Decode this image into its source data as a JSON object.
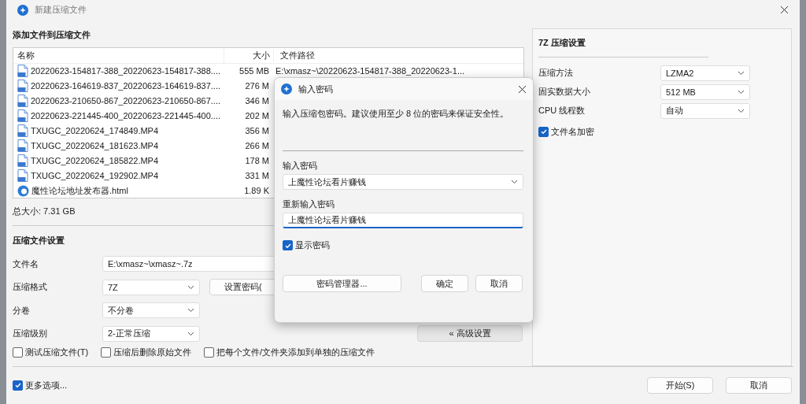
{
  "window": {
    "title": "新建压缩文件"
  },
  "files_section": {
    "title": "添加文件到压缩文件",
    "columns": [
      "名称",
      "大小",
      "文件路径"
    ],
    "rows": [
      {
        "kind": "video",
        "name": "20220623-154817-388_20220623-154817-388....",
        "size": "555 MB",
        "path": "E:\\xmasz~\\20220623-154817-388_20220623-1..."
      },
      {
        "kind": "video",
        "name": "20220623-164619-837_20220623-164619-837....",
        "size": "276 M"
      },
      {
        "kind": "video",
        "name": "20220623-210650-867_20220623-210650-867....",
        "size": "346 M"
      },
      {
        "kind": "video",
        "name": "20220623-221445-400_20220623-221445-400....",
        "size": "202 M"
      },
      {
        "kind": "video",
        "name": "TXUGC_20220624_174849.MP4",
        "size": "356 M"
      },
      {
        "kind": "video",
        "name": "TXUGC_20220624_181623.MP4",
        "size": "266 M"
      },
      {
        "kind": "video",
        "name": "TXUGC_20220624_185822.MP4",
        "size": "178 M"
      },
      {
        "kind": "video",
        "name": "TXUGC_20220624_192902.MP4",
        "size": "331 M"
      },
      {
        "kind": "web",
        "name": "魔性论坛地址发布器.html",
        "size": "1.89 K"
      }
    ],
    "total": "总大小: 7.31 GB"
  },
  "settings": {
    "title": "压缩文件设置",
    "fields": [
      {
        "kind": "text",
        "label": "文件名",
        "value": "E:\\xmasz~\\xmasz~.7z"
      },
      {
        "kind": "select",
        "label": "压缩格式",
        "value": "7Z"
      },
      {
        "kind": "select",
        "label": "分卷",
        "value": "不分卷"
      },
      {
        "kind": "select",
        "label": "压缩级别",
        "value": "2-正常压缩"
      }
    ],
    "password_button": "设置密码(",
    "advanced_button": "« 高级设置",
    "options": [
      {
        "label": "测试压缩文件(T)",
        "checked": false
      },
      {
        "label": "压缩后删除原始文件",
        "checked": false
      },
      {
        "label": "把每个文件/文件夹添加到单独的压缩文件",
        "checked": false
      }
    ]
  },
  "right_panel": {
    "title": "7Z 压缩设置",
    "fields": [
      {
        "label": "压缩方法",
        "value": "LZMA2"
      },
      {
        "label": "固实数据大小",
        "value": "512 MB"
      },
      {
        "label": "CPU 线程数",
        "value": "自动"
      }
    ],
    "checkbox": {
      "label": "文件名加密",
      "checked": true
    }
  },
  "bottom": {
    "more_options": {
      "label": "更多选项...",
      "checked": true
    },
    "buttons": [
      "开始(S)",
      "取消"
    ]
  },
  "dialog": {
    "title": "输入密码",
    "message": "输入压缩包密码。建议使用至少 8 位的密码来保证安全性。",
    "password_label": "输入密码",
    "password_value": "上魔性论坛看片赚钱",
    "reenter_label": "重新输入密码",
    "reenter_value": "上魔性论坛看片赚钱",
    "show_password": {
      "label": "显示密码",
      "checked": true
    },
    "buttons": [
      "密码管理器...",
      "确定",
      "取消"
    ]
  }
}
